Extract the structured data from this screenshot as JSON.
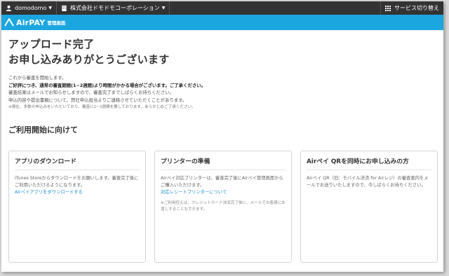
{
  "topbar": {
    "account_label": "domodomo",
    "company_label": "株式会社ドモドモコーポレーション",
    "switch_label": "サービス切り替え"
  },
  "brand": {
    "logo_text": "AirPAY",
    "subtitle": "管理画面",
    "color": "#1ba6e0"
  },
  "main": {
    "title_line1": "アップロード完了",
    "title_line2": "お申し込みありがとうございます",
    "notice": [
      "これから審査を開始します。",
      "ご好評につき、通常の審査期間(1~2週間)より時間がかかる場合がございます。ご了承ください。",
      "審査結果はメールでお知らせしますので、審査完了までしばらくお待ちください。",
      "申込内容や提出書類について、弊社申込担当よりご連絡させていただくことがあります。",
      "※現在、多数の申込みをいただいており、審査に2~3週間を要しております。あらかじめご了承ください。"
    ],
    "section_title": "ご利用開始に向けて"
  },
  "cards": [
    {
      "title": "アプリのダウンロード",
      "body": "iTunes Storeからダウンロードをお願いします。審査完了後にご利用いただけるようになります。",
      "link": "Airペイアプリをダウンロードする"
    },
    {
      "title": "プリンターの準備",
      "body": "Airペイ対応プリンターは、審査完了後にAirペイ管理画面からご購入いただけます。",
      "link": "対応レシートプリンターについて",
      "note": "※ご利用控えは、クレジットカード決済完了後に、メールでお客様にお渡しすることもできます。"
    },
    {
      "title": "Airペイ QRを同時にお申し込みの方",
      "body": "Airペイ QR（旧：モバイル決済 for Airレジ）の審査案内をメールでお送りいたしますので、今しばらくお待ちください。"
    }
  ]
}
